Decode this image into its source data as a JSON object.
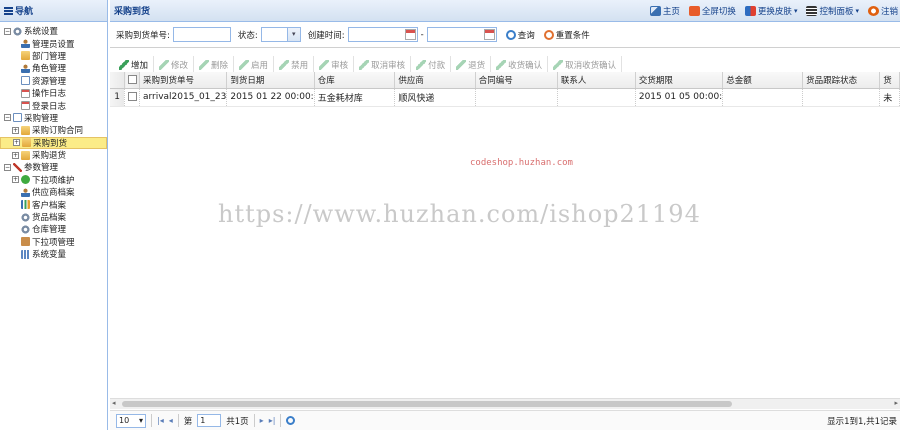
{
  "nav": {
    "title": "导航",
    "items": [
      {
        "label": "系统设置",
        "level": 1,
        "expander": "⊟",
        "icon": "gear-icon",
        "ico": "gear"
      },
      {
        "label": "管理员设置",
        "level": 2,
        "icon": "user-icon",
        "ico": "user"
      },
      {
        "label": "部门管理",
        "level": 2,
        "icon": "folder-icon",
        "ico": "folder"
      },
      {
        "label": "角色管理",
        "level": 2,
        "icon": "user-icon",
        "ico": "user"
      },
      {
        "label": "资源管理",
        "level": 2,
        "icon": "document-icon",
        "ico": "doc"
      },
      {
        "label": "操作日志",
        "level": 2,
        "icon": "calendar-icon",
        "ico": "calendar"
      },
      {
        "label": "登录日志",
        "level": 2,
        "icon": "calendar-icon",
        "ico": "calendar"
      },
      {
        "label": "采购管理",
        "level": 1,
        "expander": "⊟",
        "icon": "document-icon",
        "ico": "doc"
      },
      {
        "label": "采购订购合同",
        "level": 2,
        "expander": "⊞",
        "icon": "folder-icon",
        "ico": "folder"
      },
      {
        "label": "采购到货",
        "level": 2,
        "expander": "⊞",
        "icon": "folder-icon",
        "ico": "folder",
        "selected": true
      },
      {
        "label": "采购退货",
        "level": 2,
        "expander": "⊞",
        "icon": "folder-icon",
        "ico": "folder"
      },
      {
        "label": "参数管理",
        "level": 1,
        "expander": "⊟",
        "icon": "tools-icon",
        "ico": "tools"
      },
      {
        "label": "下拉项维护",
        "level": 2,
        "expander": "⊞",
        "icon": "green-circle-icon",
        "ico": "green"
      },
      {
        "label": "供应商档案",
        "level": 2,
        "icon": "user-icon",
        "ico": "user"
      },
      {
        "label": "客户档案",
        "level": 2,
        "icon": "chart-icon",
        "ico": "chart"
      },
      {
        "label": "货品档案",
        "level": 2,
        "icon": "gear-icon",
        "ico": "gear"
      },
      {
        "label": "仓库管理",
        "level": 2,
        "icon": "gear-icon",
        "ico": "gear"
      },
      {
        "label": "下拉项管理",
        "level": 2,
        "icon": "box-icon",
        "ico": "box"
      },
      {
        "label": "系统变量",
        "level": 2,
        "icon": "grid-icon",
        "ico": "grid"
      }
    ]
  },
  "topbar": {
    "title": "采购到货",
    "actions": [
      {
        "label": "主页",
        "icon": "home-icon",
        "ic": "home",
        "caret": ""
      },
      {
        "label": "全屏切换",
        "icon": "fullscreen-icon",
        "ic": "full",
        "caret": ""
      },
      {
        "label": "更换皮肤",
        "icon": "switch-icon",
        "ic": "switch",
        "caret": "▾"
      },
      {
        "label": "控制面板",
        "icon": "theme-icon",
        "ic": "theme",
        "caret": "▾"
      },
      {
        "label": "注销",
        "icon": "logout-icon",
        "ic": "logout",
        "caret": ""
      }
    ]
  },
  "search": {
    "order_label": "采购到货单号:",
    "status_label": "状态:",
    "created_label": "创建时间:",
    "dash": "-",
    "query_label": "查询",
    "reset_label": "重置条件"
  },
  "toolbar": [
    {
      "label": "增加",
      "disabled": false
    },
    {
      "label": "修改",
      "disabled": true
    },
    {
      "label": "删除",
      "disabled": true
    },
    {
      "label": "启用",
      "disabled": true
    },
    {
      "label": "禁用",
      "disabled": true
    },
    {
      "label": "审核",
      "disabled": true
    },
    {
      "label": "取消审核",
      "disabled": true
    },
    {
      "label": "付款",
      "disabled": true
    },
    {
      "label": "退货",
      "disabled": true
    },
    {
      "label": "收货确认",
      "disabled": true
    },
    {
      "label": "取消收货确认",
      "disabled": true
    }
  ],
  "grid": {
    "columns": [
      {
        "label": "采购到货单号",
        "w": 84
      },
      {
        "label": "到货日期",
        "w": 82
      },
      {
        "label": "仓库",
        "w": 82
      },
      {
        "label": "供应商",
        "w": 82
      },
      {
        "label": "合同编号",
        "w": 84
      },
      {
        "label": "联系人",
        "w": 80
      },
      {
        "label": "交货期限",
        "w": 82
      },
      {
        "label": "总金额",
        "w": 82
      },
      {
        "label": "货品跟踪状态",
        "w": 78
      },
      {
        "label": "货",
        "w": 20
      }
    ],
    "rows": [
      {
        "num": "1",
        "cells": [
          "arrival2015_01_23",
          "2015 01 22 00:00:",
          "五金耗材库",
          "顺风快递",
          "",
          "",
          "2015 01 05 00:00:",
          "",
          "",
          "未"
        ]
      }
    ]
  },
  "watermark": {
    "small": "codeshop.huzhan.com",
    "big": "https://www.huzhan.com/ishop21194"
  },
  "pager": {
    "page_size": "10",
    "page_prefix": "第",
    "page_value": "1",
    "page_suffix": "共1页",
    "info": "显示1到1,共1记录"
  }
}
